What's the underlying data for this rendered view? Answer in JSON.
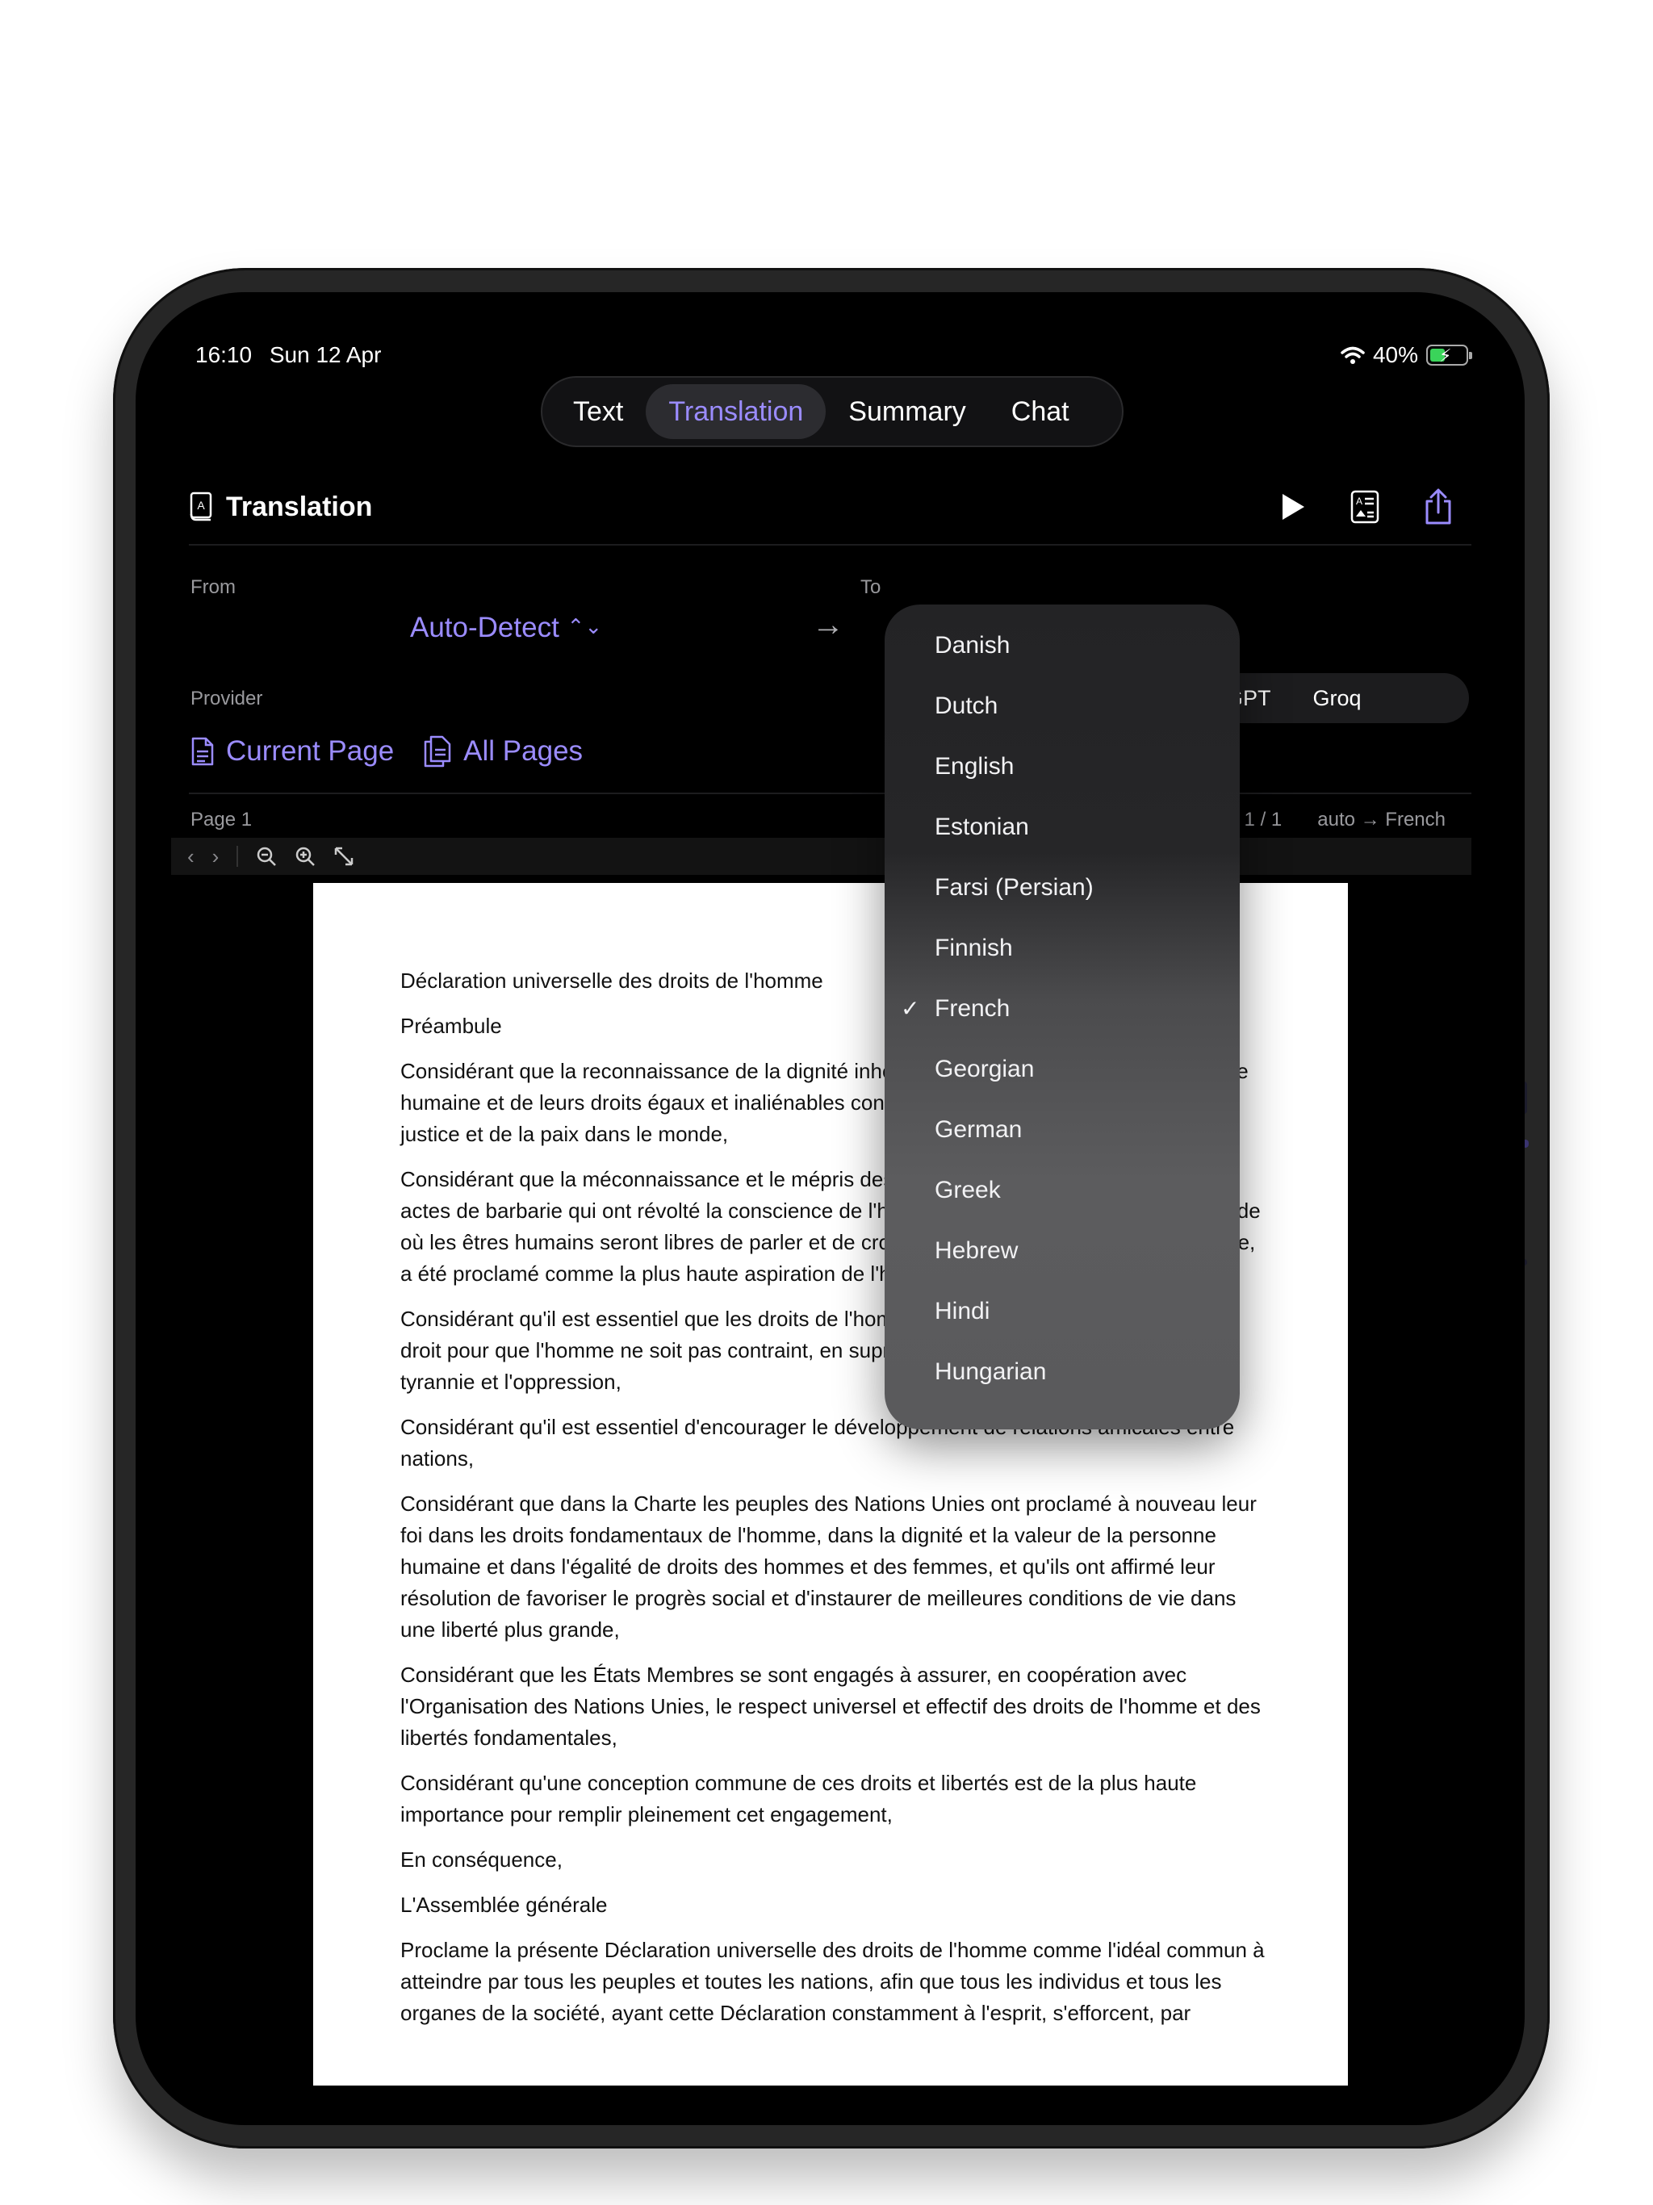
{
  "status": {
    "time": "16:10",
    "date": "Sun 12 Apr",
    "battery": "40%",
    "battery_level": 0.4
  },
  "tabs": [
    {
      "label": "Text"
    },
    {
      "label": "Translation"
    },
    {
      "label": "Summary"
    },
    {
      "label": "Chat"
    }
  ],
  "active_tab": "Translation",
  "header": {
    "title": "Translation"
  },
  "from": {
    "label": "From",
    "value": "Auto-Detect"
  },
  "to": {
    "label": "To",
    "selected": "French"
  },
  "provider": {
    "label": "Provider",
    "options": [
      "ChatGPT",
      "Groq"
    ]
  },
  "pages": {
    "current": "Current Page",
    "all": "All Pages"
  },
  "pageinfo": {
    "page": "Page 1",
    "count": "1 / 1",
    "direction": "auto → French"
  },
  "icons": [
    "book-icon",
    "play-icon",
    "flashcard-icon",
    "share-icon",
    "arrow-right-icon",
    "page-icon",
    "pages-icon",
    "chevron-left-icon",
    "chevron-right-icon",
    "zoom-out-icon",
    "zoom-in-icon",
    "expand-icon",
    "wifi-icon",
    "battery-icon"
  ],
  "accent": "#9b8cff",
  "languages": [
    "Danish",
    "Dutch",
    "English",
    "Estonian",
    "Farsi (Persian)",
    "Finnish",
    "French",
    "Georgian",
    "German",
    "Greek",
    "Hebrew",
    "Hindi",
    "Hungarian"
  ],
  "document": {
    "title": "Déclaration universelle des droits de l'homme",
    "paragraphs": [
      "Préambule",
      "Considérant que la reconnaissance de la dignité inhérente à tous les membres de la famille humaine et de leurs droits égaux et inaliénables constitue le fondement de la liberté, de la justice et de la paix dans le monde,",
      "Considérant que la méconnaissance et le mépris des droits de l'homme ont conduit à des actes de barbarie qui ont révolté la conscience de l'humanité et que l'avènement d'un monde où les êtres humains seront libres de parler et de croire, libérés de la terreur et de la misère, a été proclamé comme la plus haute aspiration de l'homme,",
      "Considérant qu'il est essentiel que les droits de l'homme soient protégés par un régime de droit pour que l'homme ne soit pas contraint, en suprême recours, à la révolte contre la tyrannie et l'oppression,",
      "Considérant qu'il est essentiel d'encourager le développement de relations amicales entre nations,",
      "Considérant que dans la Charte les peuples des Nations Unies ont proclamé à nouveau leur foi dans les droits fondamentaux de l'homme, dans la dignité et la valeur de la personne humaine et dans l'égalité de droits des hommes et des femmes, et qu'ils ont affirmé leur résolution de favoriser le progrès social et d'instaurer de meilleures conditions de vie dans une liberté plus grande,",
      "Considérant que les États Membres se sont engagés à assurer, en coopération avec l'Organisation des Nations Unies, le respect universel et effectif des droits de l'homme et des libertés fondamentales,",
      "Considérant qu'une conception commune de ces droits et libertés est de la plus haute importance pour remplir pleinement cet engagement,",
      "En conséquence,",
      "L'Assemblée générale",
      "Proclame la présente Déclaration universelle des droits de l'homme comme l'idéal commun à atteindre par tous les peuples et toutes les nations, afin que tous les individus et tous les organes de la société, ayant cette Déclaration constamment à l'esprit, s'efforcent, par"
    ]
  }
}
